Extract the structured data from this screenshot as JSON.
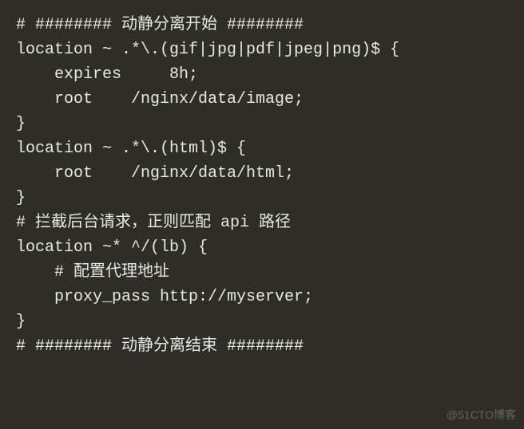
{
  "code": {
    "lines": [
      "# ######## 动静分离开始 ########",
      "location ~ .*\\.(gif|jpg|pdf|jpeg|png)$ {",
      "    expires     8h;",
      "    root    /nginx/data/image;",
      "}",
      "",
      "location ~ .*\\.(html)$ {",
      "    root    /nginx/data/html;",
      "}",
      "",
      "# 拦截后台请求，正则匹配 api 路径",
      "location ~* ^/(lb) {",
      "    # 配置代理地址",
      "    proxy_pass http://myserver;",
      "}",
      "# ######## 动静分离结束 ########"
    ]
  },
  "watermark": "@51CTO博客"
}
